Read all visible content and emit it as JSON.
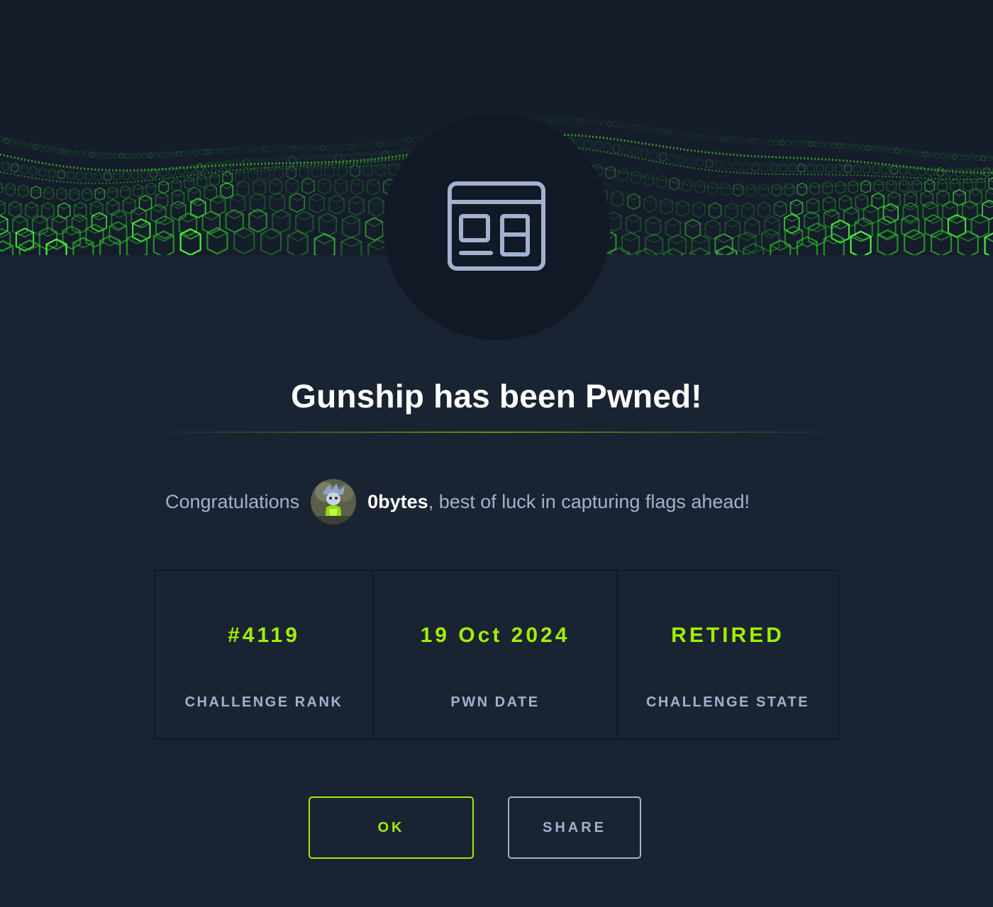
{
  "header": {
    "challenge_icon": "web-challenge-icon",
    "background": "green-cube-wave"
  },
  "title": "Gunship has been Pwned!",
  "congrats": {
    "lead": "Congratulations",
    "username": "0bytes",
    "message": ", best of luck in capturing flags ahead!",
    "avatar": "user-avatar"
  },
  "stats": [
    {
      "value": "#4119",
      "label": "CHALLENGE RANK"
    },
    {
      "value": "19 Oct 2024",
      "label": "PWN DATE"
    },
    {
      "value": "RETIRED",
      "label": "CHALLENGE STATE"
    }
  ],
  "buttons": {
    "ok": "OK",
    "share": "SHARE"
  },
  "colors": {
    "accent": "#9fef00",
    "background": "#1a2332",
    "header_background": "#151d2b",
    "circle": "#111927",
    "muted_text": "#a4b1cd"
  }
}
